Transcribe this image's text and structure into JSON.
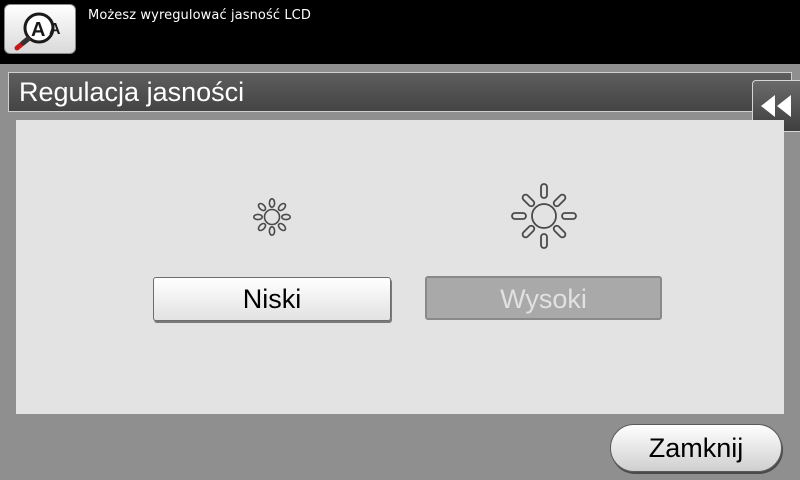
{
  "status_bar": {
    "message": "Możesz wyregulować jasność LCD",
    "app_icon": "accessibility-magnifier-icon"
  },
  "panel": {
    "title": "Regulacja jasności",
    "back_icon": "double-chevron-left-icon"
  },
  "brightness": {
    "low_icon": "sun-small-icon",
    "high_icon": "sun-large-icon",
    "low_label": "Niski",
    "high_label": "Wysoki",
    "selected": "Wysoki"
  },
  "footer": {
    "close_label": "Zamknij"
  }
}
